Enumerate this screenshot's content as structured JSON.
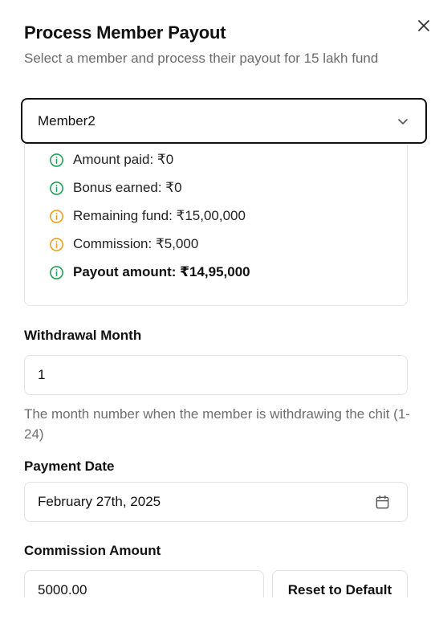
{
  "dialog": {
    "title": "Process Member Payout",
    "subtitle": "Select a member and process their payout for 15 lakh fund"
  },
  "member_select": {
    "value": "Member2"
  },
  "summary": [
    {
      "text": "Amount paid: ₹0",
      "status": "success",
      "color": "#22a35a",
      "bold": false
    },
    {
      "text": "Bonus earned: ₹0",
      "status": "success",
      "color": "#22a35a",
      "bold": false
    },
    {
      "text": "Remaining fund: ₹15,00,000",
      "status": "warning",
      "color": "#f0a020",
      "bold": false
    },
    {
      "text": "Commission: ₹5,000",
      "status": "warning",
      "color": "#f0a020",
      "bold": false
    },
    {
      "text": "Payout amount: ₹14,95,000",
      "status": "success",
      "color": "#22a35a",
      "bold": true
    }
  ],
  "withdrawal_month": {
    "label": "Withdrawal Month",
    "value": "1",
    "help": "The month number when the member is withdrawing the chit (1-24)"
  },
  "payment_date": {
    "label": "Payment Date",
    "value": "February 27th, 2025"
  },
  "commission": {
    "label": "Commission Amount",
    "value": "5000.00",
    "reset_label": "Reset to Default"
  },
  "icons": {
    "close": "close-icon",
    "chevron": "chevron-down-icon",
    "info": "info-circle-icon",
    "calendar": "calendar-icon"
  }
}
